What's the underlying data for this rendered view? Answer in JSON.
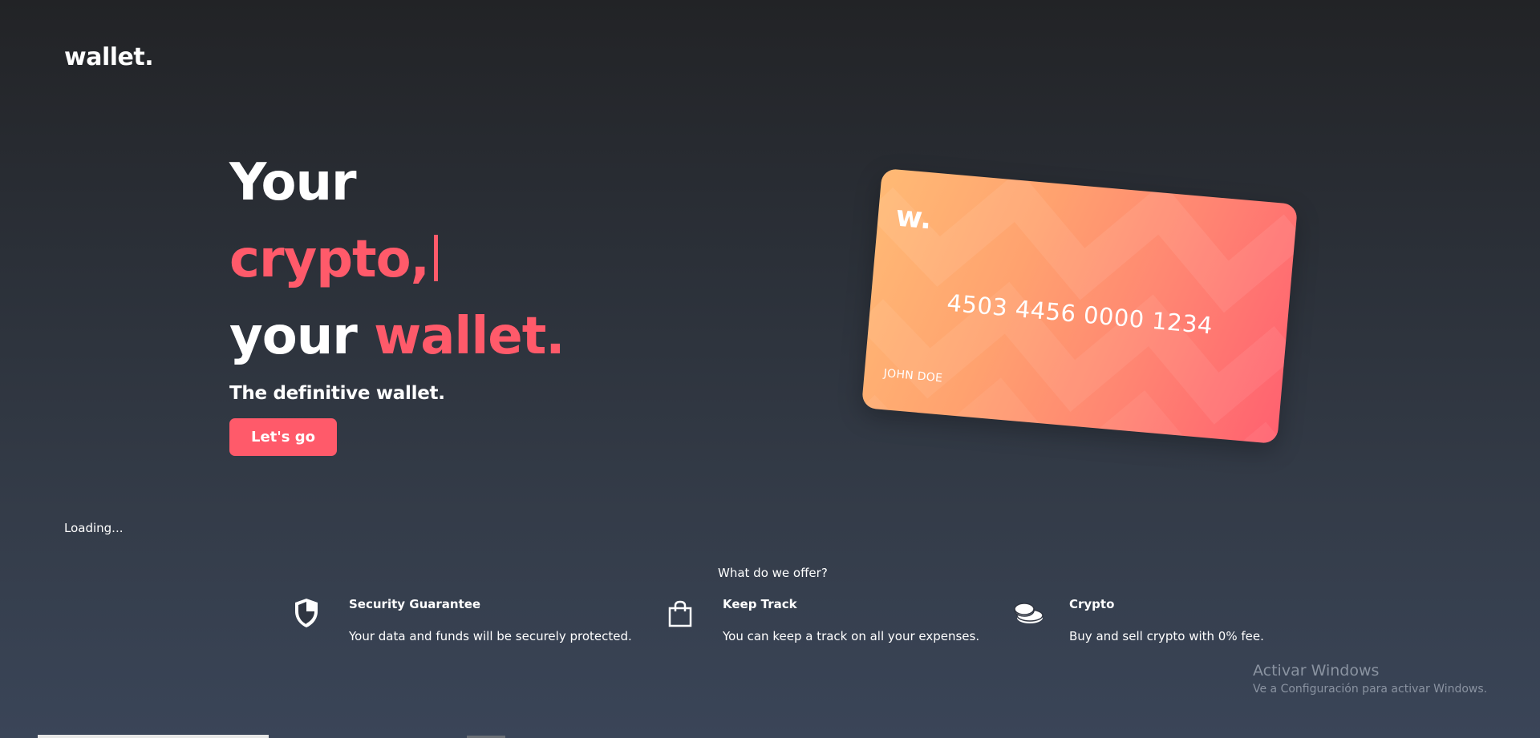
{
  "header": {
    "logo_text": "wallet."
  },
  "hero": {
    "line1": "Your",
    "line2": "crypto,",
    "line3_plain": "your",
    "line3_accent": "wallet.",
    "subtitle": "The definitive wallet.",
    "cta_label": "Let's go"
  },
  "status": {
    "loading_text": "Loading..."
  },
  "card": {
    "logo": "w.",
    "number": "4503 4456 0000 1234",
    "holder": "JOHN DOE"
  },
  "offers": {
    "title": "What do we offer?",
    "items": [
      {
        "icon": "shield-icon",
        "title": "Security Guarantee",
        "description": "Your data and funds will be securely protected."
      },
      {
        "icon": "shopping-bag-icon",
        "title": "Keep Track",
        "description": "You can keep a track on all your expenses."
      },
      {
        "icon": "coins-icon",
        "title": "Crypto",
        "description": "Buy and sell crypto with 0% fee."
      }
    ]
  },
  "watermark": {
    "title": "Activar Windows",
    "subtitle": "Ve a Configuración para activar Windows."
  },
  "colors": {
    "accent": "#ff5a6a",
    "card_start": "#ffba75",
    "card_end": "#ff6170"
  }
}
